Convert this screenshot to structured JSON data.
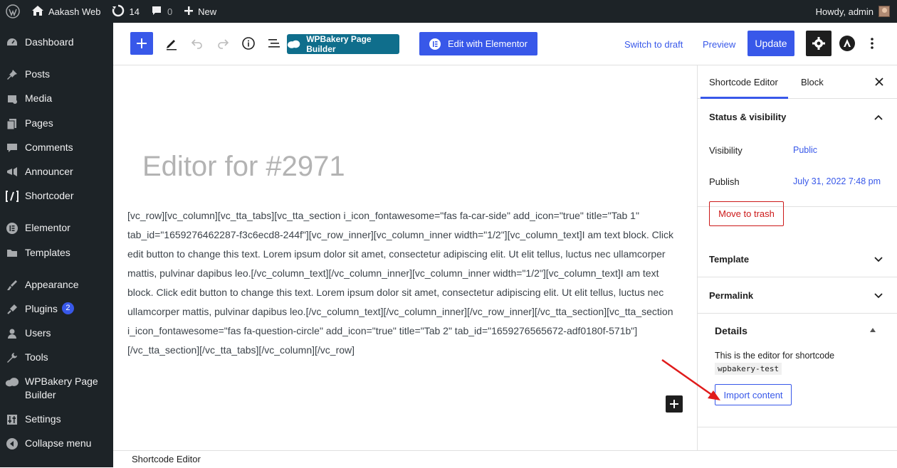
{
  "adminbar": {
    "site_name": "Aakash Web",
    "updates_count": "14",
    "comments_count": "0",
    "new_label": "New",
    "howdy": "Howdy, admin"
  },
  "sidebar": {
    "items": [
      {
        "label": "Dashboard",
        "icon": "dashboard-icon"
      },
      {
        "label": "Posts",
        "icon": "pin-icon"
      },
      {
        "label": "Media",
        "icon": "media-icon"
      },
      {
        "label": "Pages",
        "icon": "pages-icon"
      },
      {
        "label": "Comments",
        "icon": "comment-icon"
      },
      {
        "label": "Announcer",
        "icon": "megaphone-icon"
      },
      {
        "label": "Shortcoder",
        "icon": "shortcode-icon"
      },
      {
        "label": "Elementor",
        "icon": "elementor-icon"
      },
      {
        "label": "Templates",
        "icon": "folder-icon"
      },
      {
        "label": "Appearance",
        "icon": "brush-icon"
      },
      {
        "label": "Plugins",
        "icon": "plug-icon",
        "badge": "2"
      },
      {
        "label": "Users",
        "icon": "user-icon"
      },
      {
        "label": "Tools",
        "icon": "wrench-icon"
      },
      {
        "label": "WPBakery Page Builder",
        "icon": "cloud-icon"
      },
      {
        "label": "Settings",
        "icon": "settings-icon"
      },
      {
        "label": "Collapse menu",
        "icon": "collapse-icon"
      }
    ]
  },
  "toolbar": {
    "wpbakery_label": "WPBakery Page Builder",
    "elementor_label": "Edit with Elementor",
    "switch_draft_label": "Switch to draft",
    "preview_label": "Preview",
    "update_label": "Update"
  },
  "editor": {
    "title": "Editor for #2971",
    "content": "[vc_row][vc_column][vc_tta_tabs][vc_tta_section i_icon_fontawesome=\"fas fa-car-side\" add_icon=\"true\" title=\"Tab 1\" tab_id=\"1659276462287-f3c6ecd8-244f\"][vc_row_inner][vc_column_inner width=\"1/2\"][vc_column_text]I am text block. Click edit button to change this text. Lorem ipsum dolor sit amet, consectetur adipiscing elit. Ut elit tellus, luctus nec ullamcorper mattis, pulvinar dapibus leo.[/vc_column_text][/vc_column_inner][vc_column_inner width=\"1/2\"][vc_column_text]I am text block. Click edit button to change this text. Lorem ipsum dolor sit amet, consectetur adipiscing elit. Ut elit tellus, luctus nec ullamcorper mattis, pulvinar dapibus leo.[/vc_column_text][/vc_column_inner][/vc_row_inner][/vc_tta_section][vc_tta_section i_icon_fontawesome=\"fas fa-question-circle\" add_icon=\"true\" title=\"Tab 2\" tab_id=\"1659276565672-adf0180f-571b\"][/vc_tta_section][/vc_tta_tabs][/vc_column][/vc_row]"
  },
  "panel": {
    "tab_shortcode": "Shortcode Editor",
    "tab_block": "Block",
    "status_title": "Status & visibility",
    "visibility_label": "Visibility",
    "visibility_value": "Public",
    "publish_label": "Publish",
    "publish_value": "July 31, 2022 7:48 pm",
    "trash_label": "Move to trash",
    "template_title": "Template",
    "permalink_title": "Permalink",
    "details_title": "Details",
    "details_desc": "This is the editor for shortcode",
    "details_code": "wpbakery-test",
    "import_label": "Import content"
  },
  "footer": {
    "breadcrumb": "Shortcode Editor"
  },
  "colors": {
    "accent": "#3858e9",
    "admin_dark": "#1d2327",
    "danger": "#cc1818",
    "wpbakery": "#0f6e8c",
    "annotation": "#e01b1b"
  }
}
